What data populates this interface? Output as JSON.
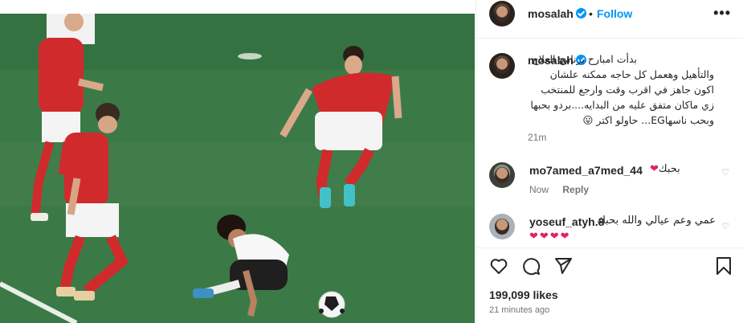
{
  "post": {
    "username": "mosalah",
    "follow_label": "Follow",
    "separator": "•",
    "more_label": "•••",
    "caption": "بدأت امبارح برنامج العلاج والتأهيل وهعمل كل حاجه ممكنه علشان اكون جاهز في اقرب وقت وارجع للمنتخب زي ماكان متفق عليه من البدايه....بردو بحبها وبحب ناسهاEG... حاولو اكتر 😛",
    "caption_time": "21m",
    "likes": "199,099 likes",
    "posted_ago": "21 minutes ago"
  },
  "comments": [
    {
      "username": "mo7amed_a7med_44",
      "text": "بحبك",
      "hearts": "❤",
      "time": "Now",
      "reply_label": "Reply"
    },
    {
      "username": "yoseuf_atyh.8",
      "text": "عمي وعم عيالي والله بحبك",
      "hearts": "❤❤❤❤"
    }
  ],
  "icons": [
    "verified-badge-icon",
    "more-options-icon",
    "heart-icon",
    "comment-icon",
    "share-icon",
    "bookmark-icon",
    "soccer-ball-icon"
  ],
  "colors": {
    "accent": "#0095f6",
    "pitch": "#3f7d4a",
    "kit_red": "#d32a2e",
    "heart": "#e0245e"
  }
}
